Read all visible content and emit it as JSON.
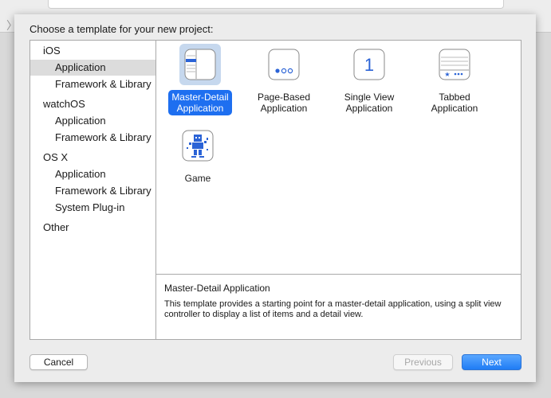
{
  "background_window": {
    "back_chevron": "〉"
  },
  "sheet": {
    "title": "Choose a template for your new project:"
  },
  "sidebar": {
    "groups": [
      {
        "label": "iOS",
        "items": [
          "Application",
          "Framework & Library"
        ]
      },
      {
        "label": "watchOS",
        "items": [
          "Application",
          "Framework & Library"
        ]
      },
      {
        "label": "OS X",
        "items": [
          "Application",
          "Framework & Library",
          "System Plug-in"
        ]
      },
      {
        "label": "Other",
        "items": []
      }
    ],
    "selected": "iOS / Application"
  },
  "templates": [
    {
      "line1": "Master-Detail",
      "line2": "Application",
      "icon": "master-detail-icon",
      "selected": true
    },
    {
      "line1": "Page-Based",
      "line2": "Application",
      "icon": "page-based-icon",
      "selected": false
    },
    {
      "line1": "Single View",
      "line2": "Application",
      "icon": "single-view-icon",
      "icon_text": "1",
      "selected": false
    },
    {
      "line1": "Tabbed",
      "line2": "Application",
      "icon": "tabbed-icon",
      "selected": false
    },
    {
      "line1": "Game",
      "line2": "",
      "icon": "game-icon",
      "selected": false
    }
  ],
  "description": {
    "title": "Master-Detail Application",
    "body": "This template provides a starting point for a master-detail application, using a split view controller to display a list of items and a detail view."
  },
  "buttons": {
    "cancel": "Cancel",
    "previous": "Previous",
    "next": "Next"
  },
  "colors": {
    "accent": "#1e6ff0",
    "selection_highlight": "#c6d8ee",
    "sidebar_selected": "#dcdcdc"
  }
}
